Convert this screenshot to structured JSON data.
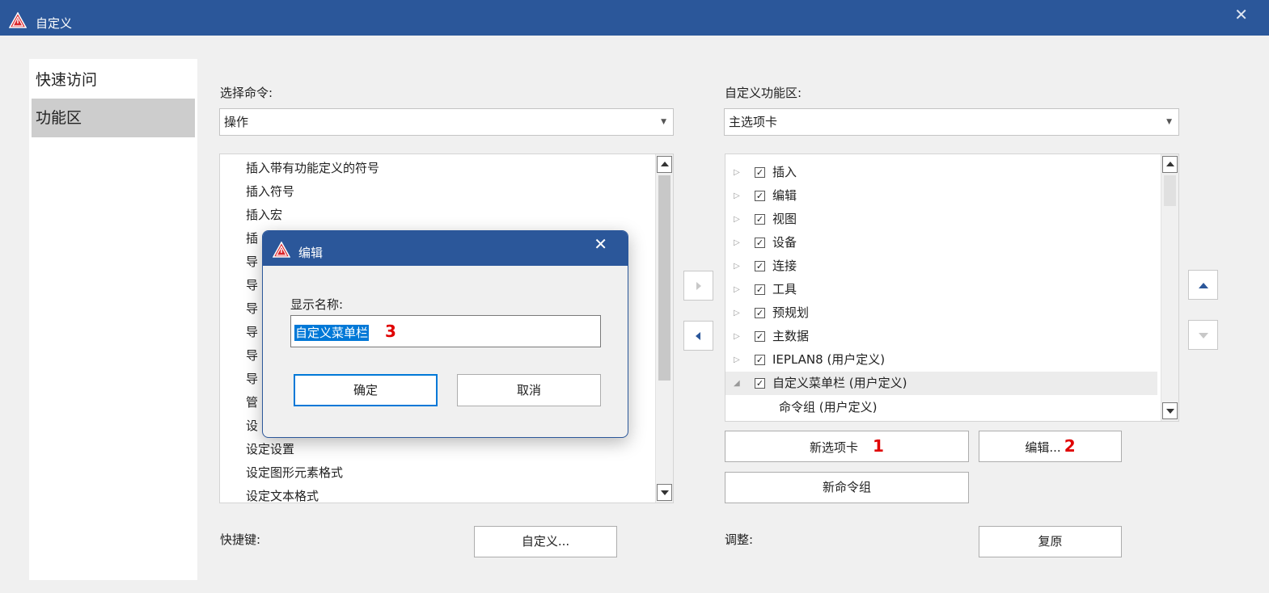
{
  "colors": {
    "titlebar": "#2b579a",
    "accent": "#0078d7",
    "annotation": "#e00000",
    "nav_selected": "#cdcdcd"
  },
  "window": {
    "title": "自定义",
    "icon": "warning-triangle-icon",
    "close_glyph": "✕"
  },
  "nav": {
    "items": [
      {
        "label": "快速访问"
      },
      {
        "label": "功能区"
      }
    ],
    "selected_index": 1
  },
  "left": {
    "title": "选择命令:",
    "combo_value": "操作",
    "items": [
      {
        "label": "插入带有功能定义的符号"
      },
      {
        "label": "插入符号"
      },
      {
        "label": "插入宏"
      },
      {
        "label": "插"
      },
      {
        "label": "导"
      },
      {
        "label": "导"
      },
      {
        "label": "导"
      },
      {
        "label": "导"
      },
      {
        "label": "导"
      },
      {
        "label": "导"
      },
      {
        "label": "管"
      },
      {
        "label": "设"
      },
      {
        "label": "设定设置"
      },
      {
        "label": "设定图形元素格式"
      },
      {
        "label": "设定文本格式"
      }
    ]
  },
  "right": {
    "title": "自定义功能区:",
    "combo_value": "主选项卡",
    "tree": [
      {
        "label": "插入",
        "expander": "▷"
      },
      {
        "label": "编辑",
        "expander": "▷"
      },
      {
        "label": "视图",
        "expander": "▷"
      },
      {
        "label": "设备",
        "expander": "▷"
      },
      {
        "label": "连接",
        "expander": "▷"
      },
      {
        "label": "工具",
        "expander": "▷"
      },
      {
        "label": "预规划",
        "expander": "▷"
      },
      {
        "label": "主数据",
        "expander": "▷"
      },
      {
        "label": "IEPLAN8 (用户定义)",
        "expander": "▷"
      },
      {
        "label": "自定义菜单栏 (用户定义)",
        "expander": "◢"
      }
    ],
    "child": {
      "label": "命令组 (用户定义)"
    },
    "check_glyph": "✓"
  },
  "buttons": {
    "new_tab": "新选项卡",
    "new_tab_marker": "1",
    "edit": "编辑...",
    "edit_marker": "2",
    "new_group": "新命令组",
    "shortcut_label": "快捷键:",
    "customize": "自定义...",
    "adjust_label": "调整:",
    "reset": "复原"
  },
  "dialog": {
    "title": "编辑",
    "field_label": "显示名称:",
    "field_value": "自定义菜单栏",
    "field_marker": "3",
    "ok": "确定",
    "cancel": "取消"
  }
}
